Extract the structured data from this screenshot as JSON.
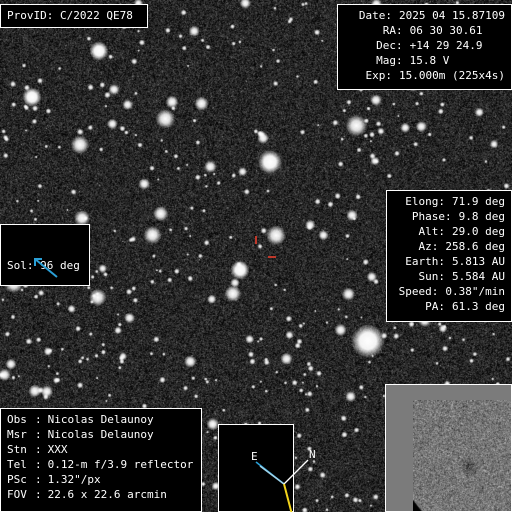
{
  "header": {
    "label": "ProvID:",
    "value": "C/2022 QE78"
  },
  "observation": [
    {
      "key": "Date",
      "value": "2025 04 15.87109"
    },
    {
      "key": "RA",
      "value": "06 30 30.61"
    },
    {
      "key": "Dec",
      "value": "+14 29 24.9"
    },
    {
      "key": "Mag",
      "value": "15.8 V"
    },
    {
      "key": "Exp",
      "value": "15.000m (225x4s)"
    }
  ],
  "sol": {
    "label": "Sol:",
    "value": "96 deg",
    "arrow_color": "#2a9fd6",
    "arrow_icon": "sun-direction-arrow-icon"
  },
  "geometry": [
    {
      "key": "Elong",
      "value": "71.9 deg"
    },
    {
      "key": "Phase",
      "value": "9.8 deg"
    },
    {
      "key": "Alt",
      "value": "29.0 deg"
    },
    {
      "key": "Az",
      "value": "258.6 deg"
    },
    {
      "key": "Earth",
      "value": "5.813 AU"
    },
    {
      "key": "Sun",
      "value": "5.584 AU"
    },
    {
      "key": "Speed",
      "value": "0.38\"/min"
    },
    {
      "key": "PA",
      "value": "61.3 deg"
    }
  ],
  "station": [
    {
      "key": "Obs",
      "value": "Nicolas Delaunoy"
    },
    {
      "key": "Msr",
      "value": "Nicolas Delaunoy"
    },
    {
      "key": "Stn",
      "value": "XXX"
    },
    {
      "key": "Tel",
      "value": "0.12-m f/3.9 reflector"
    },
    {
      "key": "PSc",
      "value": "1.32\"/px"
    },
    {
      "key": "FOV",
      "value": "22.6 x 22.6 arcmin"
    }
  ],
  "compass": {
    "east_label": "E",
    "north_label": "N",
    "east_color": "#2a9fd6",
    "north_color": "#ffffff",
    "motion_color": "#f2d31b"
  },
  "target_markers": {
    "color": "#c0392b"
  }
}
